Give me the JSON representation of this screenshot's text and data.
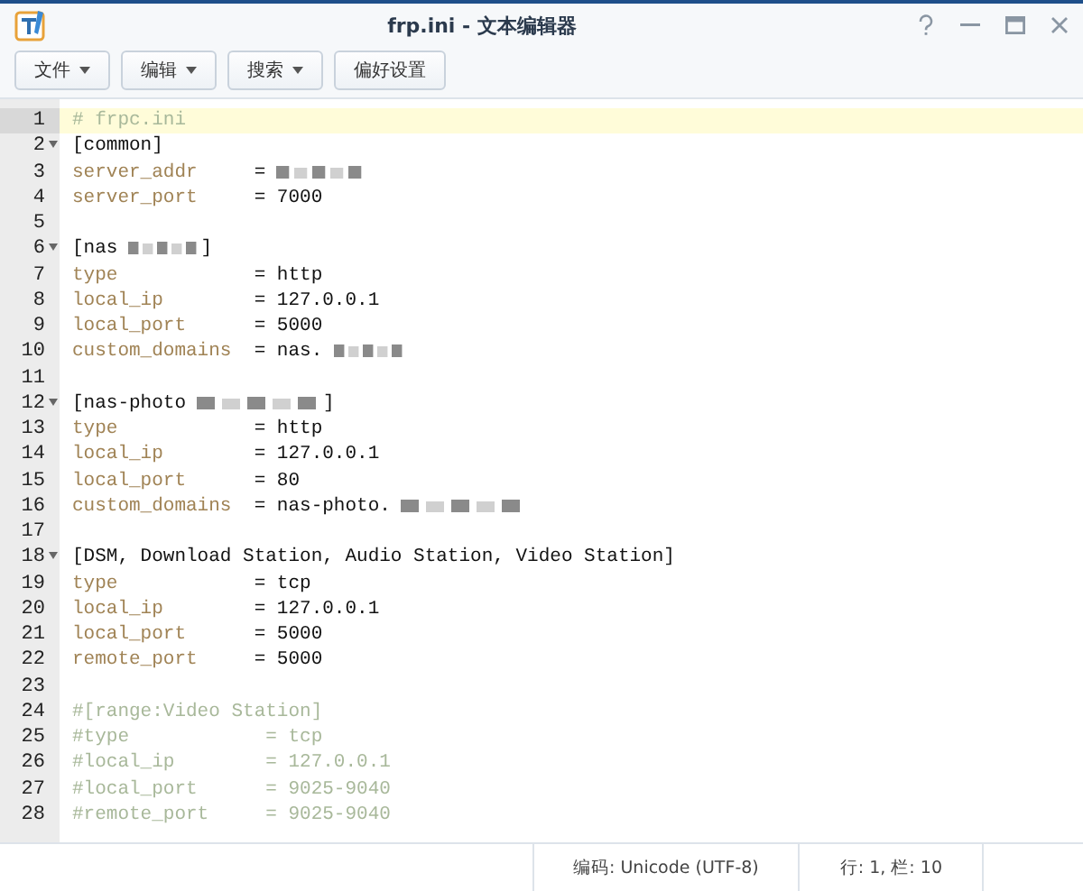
{
  "window": {
    "title": "frp.ini - 文本编辑器"
  },
  "toolbar": [
    {
      "label": "文件",
      "dropdown": true
    },
    {
      "label": "编辑",
      "dropdown": true
    },
    {
      "label": "搜索",
      "dropdown": true
    },
    {
      "label": "偏好设置",
      "dropdown": false
    }
  ],
  "editor": {
    "lines": [
      {
        "number": "1",
        "kind": "comment",
        "text": "# frpc.ini",
        "selected": true,
        "foldable": false
      },
      {
        "number": "2",
        "kind": "section",
        "text": "[common]",
        "selected": false,
        "foldable": true
      },
      {
        "number": "3",
        "kind": "pair",
        "key": "server_addr",
        "value": "=",
        "redacted": true,
        "selected": false,
        "foldable": false
      },
      {
        "number": "4",
        "kind": "pair",
        "key": "server_port",
        "value": "= 7000",
        "selected": false,
        "foldable": false
      },
      {
        "number": "5",
        "kind": "blank",
        "selected": false,
        "foldable": false
      },
      {
        "number": "6",
        "kind": "section",
        "text": "[nas",
        "redacted": true,
        "suffix": "]",
        "selected": false,
        "foldable": true
      },
      {
        "number": "7",
        "kind": "pair",
        "key": "type",
        "value": "= http",
        "selected": false,
        "foldable": false
      },
      {
        "number": "8",
        "kind": "pair",
        "key": "local_ip",
        "value": "= 127.0.0.1",
        "selected": false,
        "foldable": false
      },
      {
        "number": "9",
        "kind": "pair",
        "key": "local_port",
        "value": "= 5000",
        "selected": false,
        "foldable": false
      },
      {
        "number": "10",
        "kind": "pair",
        "key": "custom_domains",
        "value": "= nas.",
        "redacted": true,
        "selected": false,
        "foldable": false
      },
      {
        "number": "11",
        "kind": "blank",
        "selected": false,
        "foldable": false
      },
      {
        "number": "12",
        "kind": "section",
        "text": "[nas-photo",
        "redacted": true,
        "suffix": "]",
        "selected": false,
        "foldable": true
      },
      {
        "number": "13",
        "kind": "pair",
        "key": "type",
        "value": "= http",
        "selected": false,
        "foldable": false
      },
      {
        "number": "14",
        "kind": "pair",
        "key": "local_ip",
        "value": "= 127.0.0.1",
        "selected": false,
        "foldable": false
      },
      {
        "number": "15",
        "kind": "pair",
        "key": "local_port",
        "value": "= 80",
        "selected": false,
        "foldable": false
      },
      {
        "number": "16",
        "kind": "pair",
        "key": "custom_domains",
        "value": "= nas-photo.",
        "redacted": true,
        "selected": false,
        "foldable": false
      },
      {
        "number": "17",
        "kind": "blank",
        "selected": false,
        "foldable": false
      },
      {
        "number": "18",
        "kind": "section",
        "text": "[DSM, Download Station, Audio Station, Video Station]",
        "selected": false,
        "foldable": true
      },
      {
        "number": "19",
        "kind": "pair",
        "key": "type",
        "value": "= tcp",
        "selected": false,
        "foldable": false
      },
      {
        "number": "20",
        "kind": "pair",
        "key": "local_ip",
        "value": "= 127.0.0.1",
        "selected": false,
        "foldable": false
      },
      {
        "number": "21",
        "kind": "pair",
        "key": "local_port",
        "value": "= 5000",
        "selected": false,
        "foldable": false
      },
      {
        "number": "22",
        "kind": "pair",
        "key": "remote_port",
        "value": "= 5000",
        "selected": false,
        "foldable": false
      },
      {
        "number": "23",
        "kind": "blank",
        "selected": false,
        "foldable": false
      },
      {
        "number": "24",
        "kind": "comment",
        "text": "#[range:Video Station]",
        "selected": false,
        "foldable": false
      },
      {
        "number": "25",
        "kind": "comment",
        "text": "#type            = tcp",
        "selected": false,
        "foldable": false
      },
      {
        "number": "26",
        "kind": "comment",
        "text": "#local_ip        = 127.0.0.1",
        "selected": false,
        "foldable": false
      },
      {
        "number": "27",
        "kind": "comment",
        "text": "#local_port      = 9025-9040",
        "selected": false,
        "foldable": false
      },
      {
        "number": "28",
        "kind": "comment",
        "text": "#remote_port     = 9025-9040",
        "selected": false,
        "foldable": false
      }
    ]
  },
  "status_bar": {
    "encoding": "编码: Unicode (UTF-8)",
    "position": "行: 1, 栏: 10"
  }
}
